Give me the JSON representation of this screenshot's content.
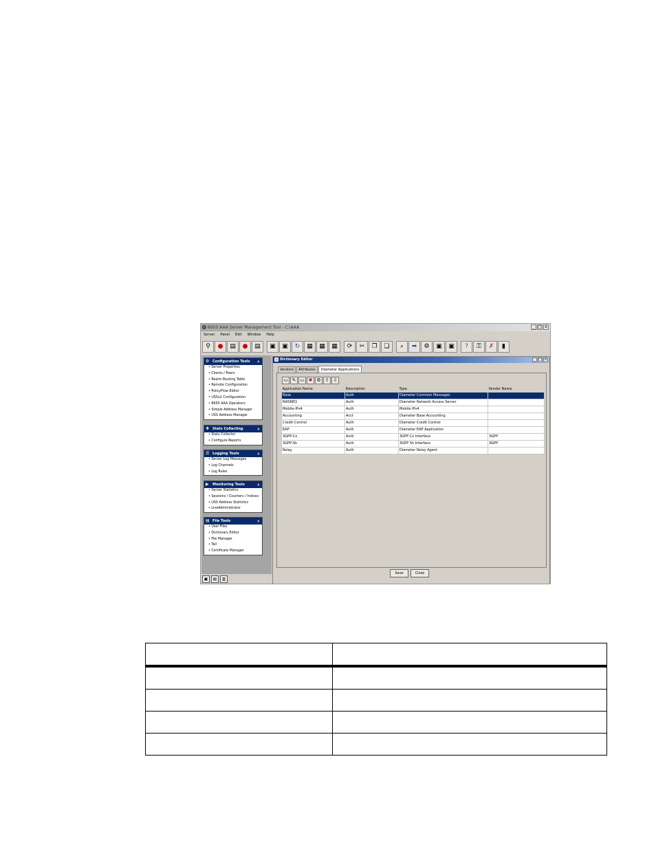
{
  "app": {
    "title": "8950 AAA Server Management Tool - C:\\AAA",
    "window_buttons": [
      "_",
      "□",
      "x"
    ],
    "menu": [
      "Server",
      "Panel",
      "Edit",
      "Window",
      "Help"
    ],
    "toolbar_icons": [
      "link-icon",
      "record-red-icon",
      "document-icon",
      "record-red-icon",
      "document-icon",
      "save-icon",
      "save-as-icon",
      "refresh-icon",
      "form-icon",
      "stop-icon",
      "print-icon",
      "refresh-arrows-icon",
      "cut-icon",
      "copy-icon",
      "paste-icon",
      "find-icon",
      "forward-icon",
      "settings-icon",
      "server-icon",
      "panel-icon",
      "help-icon",
      "lock-icon",
      "tools-icon",
      "database-icon"
    ],
    "toolbar_glyphs": [
      "⚲",
      "●",
      "▤",
      "●",
      "▤",
      "▣",
      "▣",
      "↻",
      "▦",
      "▦",
      "▦",
      "⟳",
      "✂",
      "❐",
      "❏",
      "⌕",
      "➡",
      "⚙",
      "▣",
      "▣",
      "?",
      "⚿",
      "✗",
      "▮"
    ]
  },
  "sidebar": {
    "groups": [
      {
        "title": "Configuration Tools",
        "icon": "gear-icon",
        "glyph": "⚙",
        "items": [
          "Server Properties",
          "Clients / Peers",
          "Realm Routing Table",
          "Remote Configuration",
          "PolicyFlow Editor",
          "USSv2 Configuration",
          "8950 AAA Operators",
          "Simple Address Manager",
          "USS Address Manager"
        ]
      },
      {
        "title": "Stats Collecting",
        "icon": "stats-icon",
        "glyph": "✚",
        "items": [
          "Stats Collector",
          "Configure Reports"
        ]
      },
      {
        "title": "Logging Tools",
        "icon": "log-icon",
        "glyph": "☰",
        "items": [
          "Server Log Messages",
          "Log Channels",
          "Log Rules"
        ]
      },
      {
        "title": "Monitoring Tools",
        "icon": "monitor-icon",
        "glyph": "▶",
        "items": [
          "Server Statistics",
          "Sessions / Counters / Indices",
          "USS Address Statistics",
          "LiveAdministrator"
        ]
      },
      {
        "title": "File Tools",
        "icon": "file-icon",
        "glyph": "▤",
        "items": [
          "User Files",
          "Dictionary Editor",
          "File Manager",
          "Tail",
          "Certificate Manager"
        ]
      }
    ],
    "collapse_glyph": "«"
  },
  "statusbar_glyphs": [
    "▣",
    "▤",
    "▥"
  ],
  "dictionary": {
    "title": "Dictionary Editor",
    "tabs": [
      "Vendors",
      "Attributes",
      "Diameter Applications"
    ],
    "active_tab": 2,
    "mini_toolbar_glyphs": [
      "▭",
      "✎",
      "▭",
      "✖",
      "⚙",
      "⇧",
      "⇩"
    ],
    "columns": [
      "Application Name",
      "Description",
      "Type",
      "Vendor Name"
    ],
    "rows": [
      [
        "Base",
        "Auth",
        "Diameter Common Messages",
        ""
      ],
      [
        "NASREQ",
        "Auth",
        "Diameter Network Access Server",
        ""
      ],
      [
        "Mobile-IPv4",
        "Auth",
        "Mobile IPv4",
        ""
      ],
      [
        "Accounting",
        "Acct",
        "Diameter Base Accounting",
        ""
      ],
      [
        "Credit-Control",
        "Auth",
        "Diameter Credit Control",
        ""
      ],
      [
        "EAP",
        "Auth",
        "Diameter EAP Application",
        ""
      ],
      [
        "3GPP-Cx",
        "Auth",
        "3GPP Cx Interface",
        "3GPP"
      ],
      [
        "3GPP-Sh",
        "Auth",
        "3GPP Sh Interface",
        "3GPP"
      ],
      [
        "Relay",
        "Auth",
        "Diameter Relay Agent",
        ""
      ]
    ],
    "selected_row": 0,
    "buttons": {
      "save": "Save",
      "close": "Close"
    }
  }
}
